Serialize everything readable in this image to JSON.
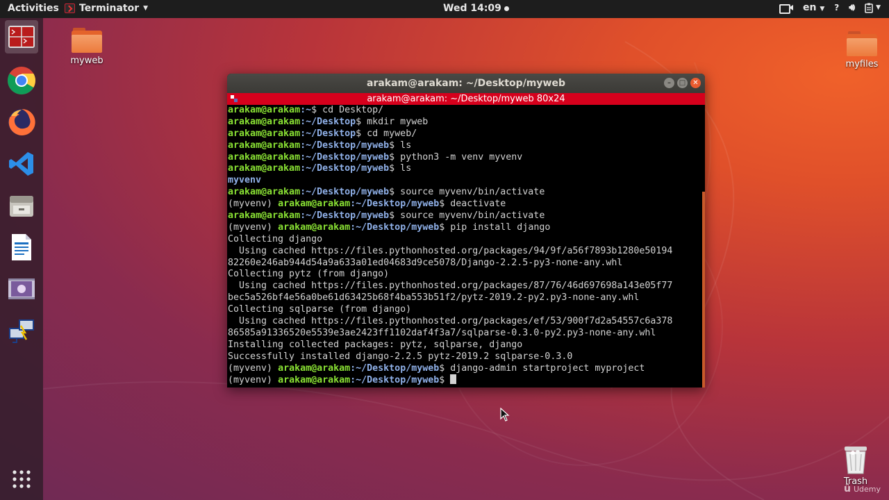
{
  "topbar": {
    "activities": "Activities",
    "app_name": "Terminator",
    "clock": "Wed 14:09",
    "lang": "en"
  },
  "dock": {
    "items": [
      {
        "name": "terminator",
        "icon": "terminal-icon",
        "active": true
      },
      {
        "name": "chrome",
        "icon": "chrome-icon"
      },
      {
        "name": "firefox",
        "icon": "firefox-icon"
      },
      {
        "name": "vscode",
        "icon": "vscode-icon"
      },
      {
        "name": "files",
        "icon": "files-icon"
      },
      {
        "name": "writer",
        "icon": "writer-icon"
      },
      {
        "name": "video",
        "icon": "video-icon"
      },
      {
        "name": "network",
        "icon": "network-icon"
      }
    ],
    "apps_grid": "show-apps-icon"
  },
  "desktop": {
    "icons": [
      {
        "label": "myweb",
        "icon": "folder-icon"
      },
      {
        "label": "myfiles",
        "icon": "folder-icon"
      },
      {
        "label": "Trash",
        "icon": "trash-icon"
      }
    ]
  },
  "window": {
    "title": "arakam@arakam: ~/Desktop/myweb",
    "tab_title": "arakam@arakam: ~/Desktop/myweb 80x24"
  },
  "terminal": {
    "lines": [
      {
        "venv": "",
        "user": "arakam@arakam",
        "path": ":~",
        "cmd": "$ cd Desktop/"
      },
      {
        "venv": "",
        "user": "arakam@arakam",
        "path": ":~/Desktop",
        "cmd": "$ mkdir myweb"
      },
      {
        "venv": "",
        "user": "arakam@arakam",
        "path": ":~/Desktop",
        "cmd": "$ cd myweb/"
      },
      {
        "venv": "",
        "user": "arakam@arakam",
        "path": ":~/Desktop/myweb",
        "cmd": "$ ls"
      },
      {
        "venv": "",
        "user": "arakam@arakam",
        "path": ":~/Desktop/myweb",
        "cmd": "$ python3 -m venv myvenv"
      },
      {
        "venv": "",
        "user": "arakam@arakam",
        "path": ":~/Desktop/myweb",
        "cmd": "$ ls"
      },
      {
        "dir": "myvenv"
      },
      {
        "venv": "",
        "user": "arakam@arakam",
        "path": ":~/Desktop/myweb",
        "cmd": "$ source myvenv/bin/activate"
      },
      {
        "venv": "(myvenv) ",
        "user": "arakam@arakam",
        "path": ":~/Desktop/myweb",
        "cmd": "$ deactivate"
      },
      {
        "venv": "",
        "user": "arakam@arakam",
        "path": ":~/Desktop/myweb",
        "cmd": "$ source myvenv/bin/activate"
      },
      {
        "venv": "(myvenv) ",
        "user": "arakam@arakam",
        "path": ":~/Desktop/myweb",
        "cmd": "$ pip install django"
      },
      {
        "out": "Collecting django"
      },
      {
        "out": "  Using cached https://files.pythonhosted.org/packages/94/9f/a56f7893b1280e50194"
      },
      {
        "out": "82260e246ab944d54a9a633a01ed04683d9ce5078/Django-2.2.5-py3-none-any.whl"
      },
      {
        "out": "Collecting pytz (from django)"
      },
      {
        "out": "  Using cached https://files.pythonhosted.org/packages/87/76/46d697698a143e05f77"
      },
      {
        "out": "bec5a526bf4e56a0be61d63425b68f4ba553b51f2/pytz-2019.2-py2.py3-none-any.whl"
      },
      {
        "out": "Collecting sqlparse (from django)"
      },
      {
        "out": "  Using cached https://files.pythonhosted.org/packages/ef/53/900f7d2a54557c6a378"
      },
      {
        "out": "86585a91336520e5539e3ae2423ff1102daf4f3a7/sqlparse-0.3.0-py2.py3-none-any.whl"
      },
      {
        "out": "Installing collected packages: pytz, sqlparse, django"
      },
      {
        "out": "Successfully installed django-2.2.5 pytz-2019.2 sqlparse-0.3.0"
      },
      {
        "venv": "(myvenv) ",
        "user": "arakam@arakam",
        "path": ":~/Desktop/myweb",
        "cmd": "$ django-admin startproject myproject"
      },
      {
        "venv": "(myvenv) ",
        "user": "arakam@arakam",
        "path": ":~/Desktop/myweb",
        "cmd": "$ ",
        "cursor": true
      }
    ]
  },
  "watermark": "Udemy",
  "colors": {
    "user_green": "#8ae234",
    "path_blue": "#8fb0e8",
    "tab_red": "#d6001c",
    "close_orange": "#ea5b2f"
  }
}
